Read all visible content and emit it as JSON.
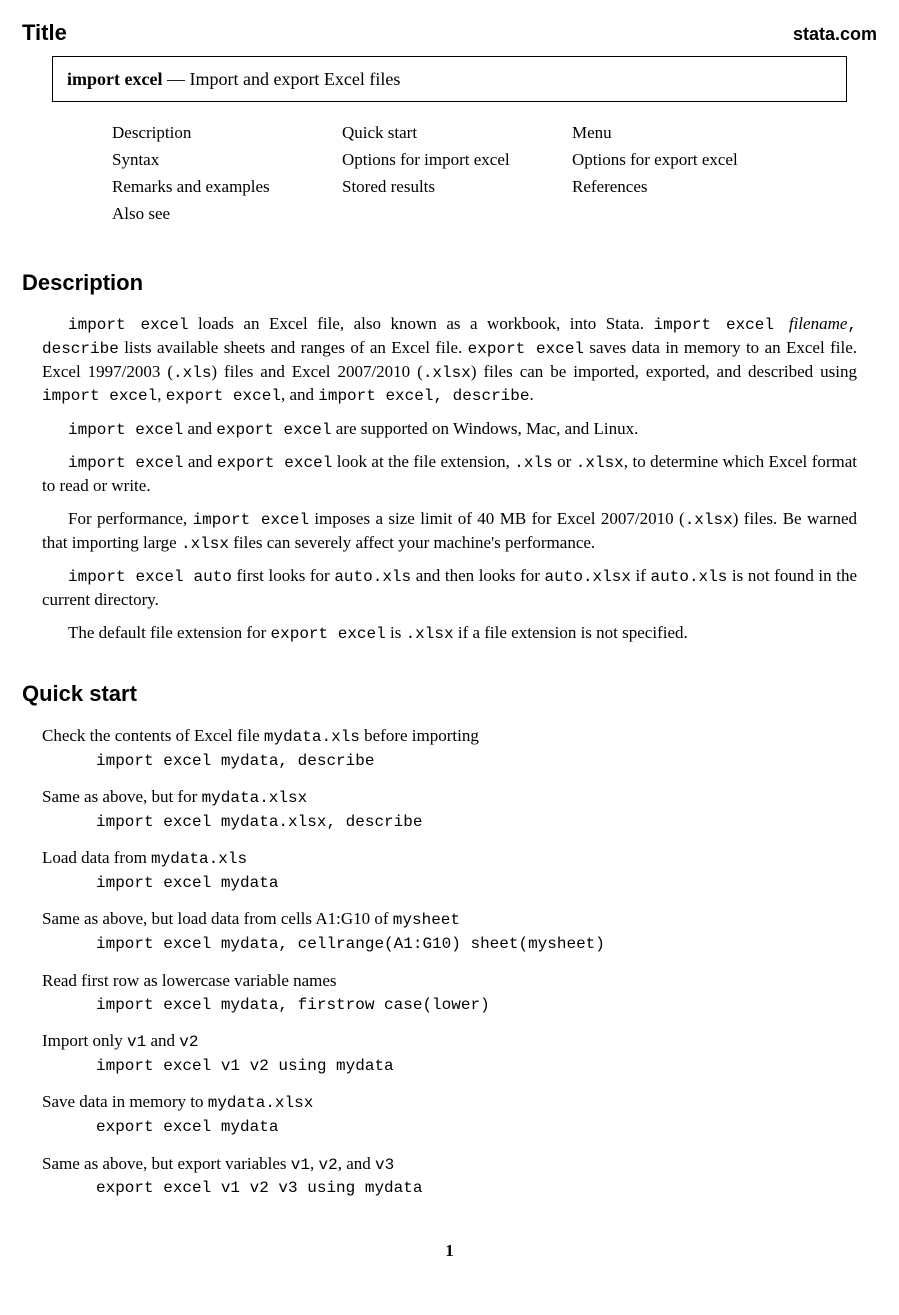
{
  "header": {
    "title_label": "Title",
    "site": "stata.com"
  },
  "title_box": {
    "command": "import excel",
    "separator": " — ",
    "subtitle": "Import and export Excel files"
  },
  "toc": {
    "rows": [
      [
        "Description",
        "Quick start",
        "Menu"
      ],
      [
        "Syntax",
        "Options for import excel",
        "Options for export excel"
      ],
      [
        "Remarks and examples",
        "Stored results",
        "References"
      ],
      [
        "Also see",
        "",
        ""
      ]
    ]
  },
  "sections": {
    "description": {
      "heading": "Description"
    },
    "quickstart": {
      "heading": "Quick start"
    }
  },
  "desc": {
    "p1_a": "import excel",
    "p1_b": " loads an Excel file, also known as a workbook, into Stata. ",
    "p1_c": "import excel ",
    "p1_d": "filename",
    "p1_e": ", describe",
    "p1_f": " lists available sheets and ranges of an Excel file. ",
    "p1_g": "export excel",
    "p1_h": " saves data in memory to an Excel file. Excel 1997/2003 (",
    "p1_i": ".xls",
    "p1_j": ") files and Excel 2007/2010 (",
    "p1_k": ".xlsx",
    "p1_l": ") files can be imported, exported, and described using ",
    "p1_m": "import excel",
    "p1_n": ", ",
    "p1_o": "export excel",
    "p1_p": ", and ",
    "p1_q": "import excel, describe",
    "p1_r": ".",
    "p2_a": "import excel",
    "p2_b": " and ",
    "p2_c": "export excel",
    "p2_d": " are supported on Windows, Mac, and Linux.",
    "p3_a": "import excel",
    "p3_b": " and ",
    "p3_c": "export excel",
    "p3_d": " look at the file extension, ",
    "p3_e": ".xls",
    "p3_f": " or ",
    "p3_g": ".xlsx",
    "p3_h": ", to determine which Excel format to read or write.",
    "p4_a": "For performance, ",
    "p4_b": "import excel",
    "p4_c": " imposes a size limit of 40 ",
    "p4_d": "MB",
    "p4_e": " for Excel 2007/2010 (",
    "p4_f": ".xlsx",
    "p4_g": ") files. Be warned that importing large ",
    "p4_h": ".xlsx",
    "p4_i": " files can severely affect your machine's performance.",
    "p5_a": "import excel auto",
    "p5_b": " first looks for ",
    "p5_c": "auto.xls",
    "p5_d": " and then looks for ",
    "p5_e": "auto.xlsx",
    "p5_f": " if ",
    "p5_g": "auto.xls",
    "p5_h": " is not found in the current directory.",
    "p6_a": "The default file extension for ",
    "p6_b": "export excel",
    "p6_c": " is ",
    "p6_d": ".xlsx",
    "p6_e": " if a file extension is not specified."
  },
  "qs": {
    "b1_d1": "Check the contents of Excel file ",
    "b1_d2": "mydata.xls",
    "b1_d3": " before importing",
    "b1_c": "import excel mydata, describe",
    "b2_d1": "Same as above, but for ",
    "b2_d2": "mydata.xlsx",
    "b2_c": "import excel mydata.xlsx, describe",
    "b3_d1": "Load data from ",
    "b3_d2": "mydata.xls",
    "b3_c": "import excel mydata",
    "b4_d1": "Same as above, but load data from cells A1:G10 of ",
    "b4_d2": "mysheet",
    "b4_c": "import excel mydata, cellrange(A1:G10) sheet(mysheet)",
    "b5_d": "Read first row as lowercase variable names",
    "b5_c": "import excel mydata, firstrow case(lower)",
    "b6_d1": "Import only ",
    "b6_d2": "v1",
    "b6_d3": " and ",
    "b6_d4": "v2",
    "b6_c": "import excel v1 v2 using mydata",
    "b7_d1": "Save data in memory to ",
    "b7_d2": "mydata.xlsx",
    "b7_c": "export excel mydata",
    "b8_d1": "Same as above, but export variables ",
    "b8_d2": "v1",
    "b8_d3": ", ",
    "b8_d4": "v2",
    "b8_d5": ", and ",
    "b8_d6": "v3",
    "b8_c": "export excel v1 v2 v3 using mydata"
  },
  "page_number": "1"
}
